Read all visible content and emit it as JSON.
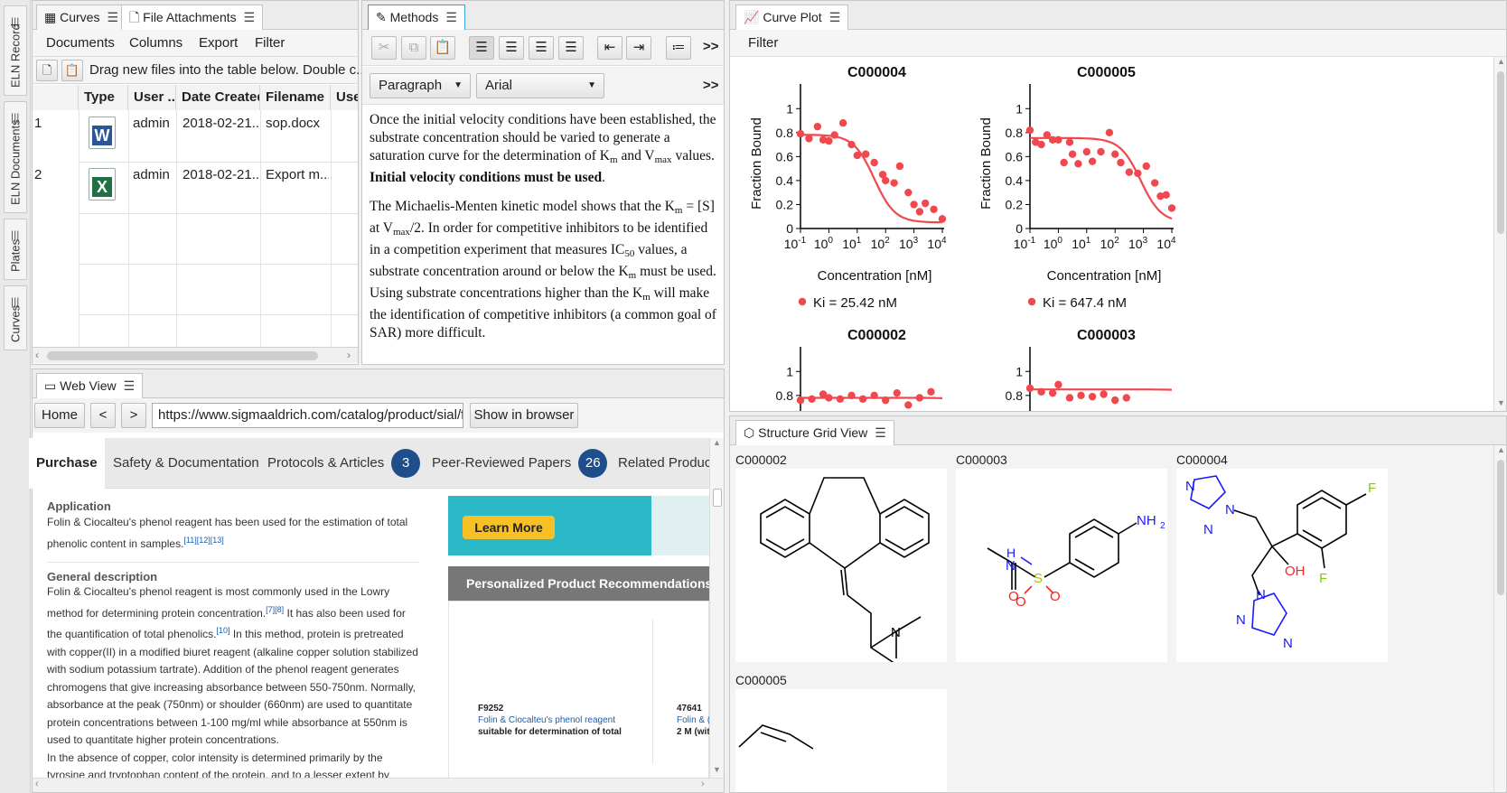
{
  "sidebar": {
    "tabs": [
      {
        "label": "ELN Record"
      },
      {
        "label": "ELN Documents"
      },
      {
        "label": "Plates"
      },
      {
        "label": "Curves"
      }
    ]
  },
  "attachments": {
    "tabs": [
      {
        "label": "Curves"
      },
      {
        "label": "File Attachments"
      }
    ],
    "menu": [
      "Documents",
      "Columns",
      "Export",
      "Filter"
    ],
    "hint": "Drag new files into the table below. Double c...",
    "columns": [
      "Type",
      "User ...",
      "Date Created",
      "Filename",
      "Use"
    ],
    "rows": [
      {
        "num": "1",
        "type": "word-icon",
        "icon_letter": "W",
        "user": "admin",
        "date": "2018-02-21...",
        "filename": "sop.docx"
      },
      {
        "num": "2",
        "type": "excel-icon",
        "icon_letter": "X",
        "user": "admin",
        "date": "2018-02-21...",
        "filename": "Export m..."
      }
    ]
  },
  "methods": {
    "tab": "Methods",
    "paragraph_style": "Paragraph",
    "font": "Arial",
    "more": ">>",
    "p1": {
      "a": "Once the initial velocity conditions have been established, the substrate concentration should be varied to generate a saturation curve for the determination of K",
      "sub1": "m",
      "b": " and V",
      "sub2": "max",
      "c": " values. ",
      "bold": "Initial velocity conditions must be used",
      "d": "."
    },
    "p2": {
      "a": "The Michaelis-Menten kinetic model shows that the K",
      "sub1": "m",
      "b": " = [S] at V",
      "sub2": "max",
      "c": "/2. In order for competitive inhibitors to be identified in a competition experiment that measures IC",
      "sub3": "50",
      "d": " values, a substrate concentration around or below the K",
      "sub4": "m",
      "e": " must be used. Using substrate concentrations higher than the K",
      "sub5": "m",
      "f": " will make the identification of competitive inhibitors (a common goal of SAR) more difficult."
    }
  },
  "curve_plot": {
    "tab": "Curve Plot",
    "filter": "Filter",
    "xlabel": "Concentration [nM]",
    "ylabel": "Fraction Bound",
    "ylabel_cut": "ound",
    "yticks": [
      "0",
      "0.2",
      "0.4",
      "0.6",
      "0.8",
      "1"
    ],
    "xticks": [
      {
        "b": "10",
        "e": "-1"
      },
      {
        "b": "10",
        "e": "0"
      },
      {
        "b": "10",
        "e": "1"
      },
      {
        "b": "10",
        "e": "2"
      },
      {
        "b": "10",
        "e": "3"
      },
      {
        "b": "10",
        "e": "4"
      }
    ],
    "series_color": "#f0484e",
    "plots": [
      {
        "title": "C000004",
        "legend": "Ki = 25.42 nM",
        "points": [
          [
            -1,
            0.79
          ],
          [
            -0.7,
            0.75
          ],
          [
            -0.4,
            0.85
          ],
          [
            -0.2,
            0.74
          ],
          [
            0,
            0.73
          ],
          [
            0.2,
            0.78
          ],
          [
            0.5,
            0.88
          ],
          [
            0.8,
            0.7
          ],
          [
            1.0,
            0.61
          ],
          [
            1.3,
            0.62
          ],
          [
            1.6,
            0.55
          ],
          [
            1.9,
            0.45
          ],
          [
            2.0,
            0.4
          ],
          [
            2.3,
            0.38
          ],
          [
            2.5,
            0.52
          ],
          [
            2.8,
            0.3
          ],
          [
            3.0,
            0.2
          ],
          [
            3.2,
            0.14
          ],
          [
            3.4,
            0.21
          ],
          [
            3.7,
            0.16
          ],
          [
            4.0,
            0.08
          ]
        ],
        "ec": 1.6
      },
      {
        "title": "C000005",
        "legend": "Ki = 647.4 nM",
        "points": [
          [
            -1,
            0.82
          ],
          [
            -0.8,
            0.72
          ],
          [
            -0.6,
            0.7
          ],
          [
            -0.4,
            0.78
          ],
          [
            -0.2,
            0.74
          ],
          [
            0,
            0.74
          ],
          [
            0.2,
            0.55
          ],
          [
            0.4,
            0.72
          ],
          [
            0.5,
            0.62
          ],
          [
            0.7,
            0.54
          ],
          [
            1.0,
            0.64
          ],
          [
            1.2,
            0.56
          ],
          [
            1.5,
            0.64
          ],
          [
            1.8,
            0.8
          ],
          [
            2.0,
            0.62
          ],
          [
            2.2,
            0.55
          ],
          [
            2.5,
            0.47
          ],
          [
            2.8,
            0.46
          ],
          [
            3.1,
            0.52
          ],
          [
            3.4,
            0.38
          ],
          [
            3.6,
            0.27
          ],
          [
            3.8,
            0.28
          ],
          [
            4.0,
            0.17
          ]
        ],
        "ec": 2.9
      },
      {
        "title": "C000002",
        "points": [
          [
            -1,
            0.76
          ],
          [
            -0.6,
            0.77
          ],
          [
            -0.2,
            0.81
          ],
          [
            0,
            0.78
          ],
          [
            0.4,
            0.77
          ],
          [
            0.8,
            0.8
          ],
          [
            1.2,
            0.77
          ],
          [
            1.6,
            0.8
          ],
          [
            2.0,
            0.76
          ],
          [
            2.4,
            0.82
          ],
          [
            2.8,
            0.72
          ],
          [
            3.2,
            0.78
          ],
          [
            3.6,
            0.83
          ]
        ],
        "ec": 6
      },
      {
        "title": "C000003",
        "points": [
          [
            -1,
            0.86
          ],
          [
            -0.6,
            0.83
          ],
          [
            -0.2,
            0.82
          ],
          [
            0,
            0.89
          ],
          [
            0.4,
            0.78
          ],
          [
            0.8,
            0.8
          ],
          [
            1.2,
            0.79
          ],
          [
            1.6,
            0.81
          ],
          [
            2.0,
            0.76
          ],
          [
            2.4,
            0.78
          ]
        ],
        "ec": 6
      }
    ]
  },
  "web_view": {
    "tab": "Web View",
    "home": "Home",
    "back": "<",
    "forward": ">",
    "url": "https://www.sigmaaldrich.com/catalog/product/sial/f",
    "show_in_browser": "Show in browser",
    "tabs": [
      {
        "label": "Purchase"
      },
      {
        "label": "Safety & Documentation"
      },
      {
        "label": "Protocols & Articles",
        "badge": "3"
      },
      {
        "label": "Peer-Reviewed Papers",
        "badge": "26"
      },
      {
        "label": "Related Product"
      }
    ],
    "application_heading": "Application",
    "application_text": "Folin & Ciocalteu's phenol reagent has been used for the estimation of total phenolic content in samples.",
    "application_refs": "[11][12][13]",
    "general_heading": "General description",
    "general_1": "Folin & Ciocalteu's phenol reagent is most commonly used in the Lowry method for determining protein concentration.",
    "general_refs1": "[7][8]",
    "general_2": " It has also been used for the quantification of total phenolics.",
    "general_refs2": "[10]",
    "general_3": " In this method, protein is pretreated with copper(II) in a modified biuret reagent (alkaline copper solution stabilized with sodium potassium tartrate). Addition of the phenol reagent generates chromogens that give increasing absorbance between 550-750nm. Normally, absorbance at the peak (750nm) or shoulder (660nm) are used to quantitate protein concentrations between 1-100 mg/ml while absorbance at 550nm is used to quantitate higher protein concentrations.",
    "general_4": "In the absence of copper, color intensity is determined primarily by the tyrosine and tryptophan content of the protein, and to a lesser extent by cysteine and",
    "learn_more": "Learn More",
    "recs_heading": "Personalized Product Recommendations",
    "rec1": {
      "code": "F9252",
      "name": "Folin & Ciocalteu's phenol reagent",
      "desc": "suitable for determination of total"
    },
    "rec2": {
      "code": "47641",
      "name": "Folin & (",
      "desc": "2 M (wit"
    }
  },
  "structure_grid": {
    "tab": "Structure Grid View",
    "compounds": [
      {
        "id": "C000002"
      },
      {
        "id": "C000003"
      },
      {
        "id": "C000004"
      },
      {
        "id": "C000005"
      }
    ],
    "labels": {
      "n": "N",
      "o": "O",
      "s": "S",
      "h": "H",
      "f": "F",
      "oh": "OH",
      "nh2": "NH",
      "nh2_sub": "2"
    }
  }
}
